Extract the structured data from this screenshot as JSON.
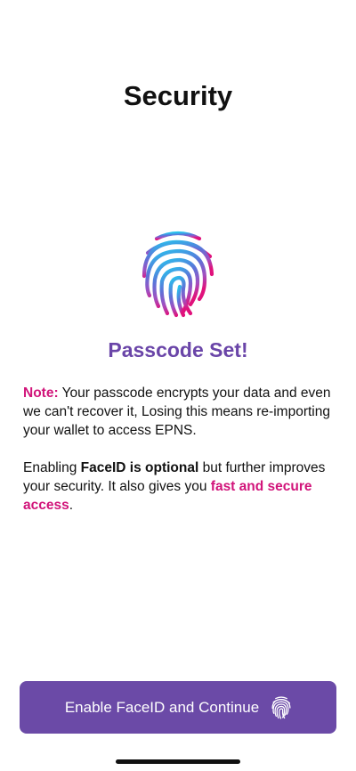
{
  "header": {
    "title": "Security"
  },
  "hero": {
    "icon": "fingerprint-icon",
    "headline": "Passcode Set!"
  },
  "note": {
    "label": "Note:",
    "text": "Your passcode encrypts your data and even we can't recover it, Losing this means re-importing your wallet to access EPNS."
  },
  "faceid_info": {
    "prefix": "Enabling ",
    "bold": "FaceID is optional",
    "middle": " but further improves your security. It also gives you ",
    "highlight": "fast and secure access",
    "suffix": "."
  },
  "actions": {
    "continue_label": "Enable FaceID and Continue",
    "continue_icon": "fingerprint-icon"
  },
  "colors": {
    "accent": "#6b4aa7",
    "headline": "#6a45a8",
    "highlight": "#d1147a"
  }
}
